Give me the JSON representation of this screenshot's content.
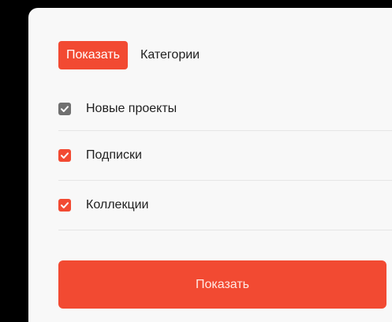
{
  "tabs": [
    {
      "label": "Показать",
      "active": true
    },
    {
      "label": "Категории",
      "active": false
    }
  ],
  "options": [
    {
      "label": "Новые проекты",
      "checked": true,
      "state": "disabled"
    },
    {
      "label": "Подписки",
      "checked": true,
      "state": "enabled"
    },
    {
      "label": "Коллекции",
      "checked": true,
      "state": "enabled"
    }
  ],
  "submit": {
    "label": "Показать"
  },
  "colors": {
    "accent": "#f24a32",
    "checkbox_disabled": "#707070",
    "panel_background": "#f8f8f8",
    "outer_background": "#000000"
  },
  "icons": {
    "checkbox_mark": "check-icon"
  }
}
